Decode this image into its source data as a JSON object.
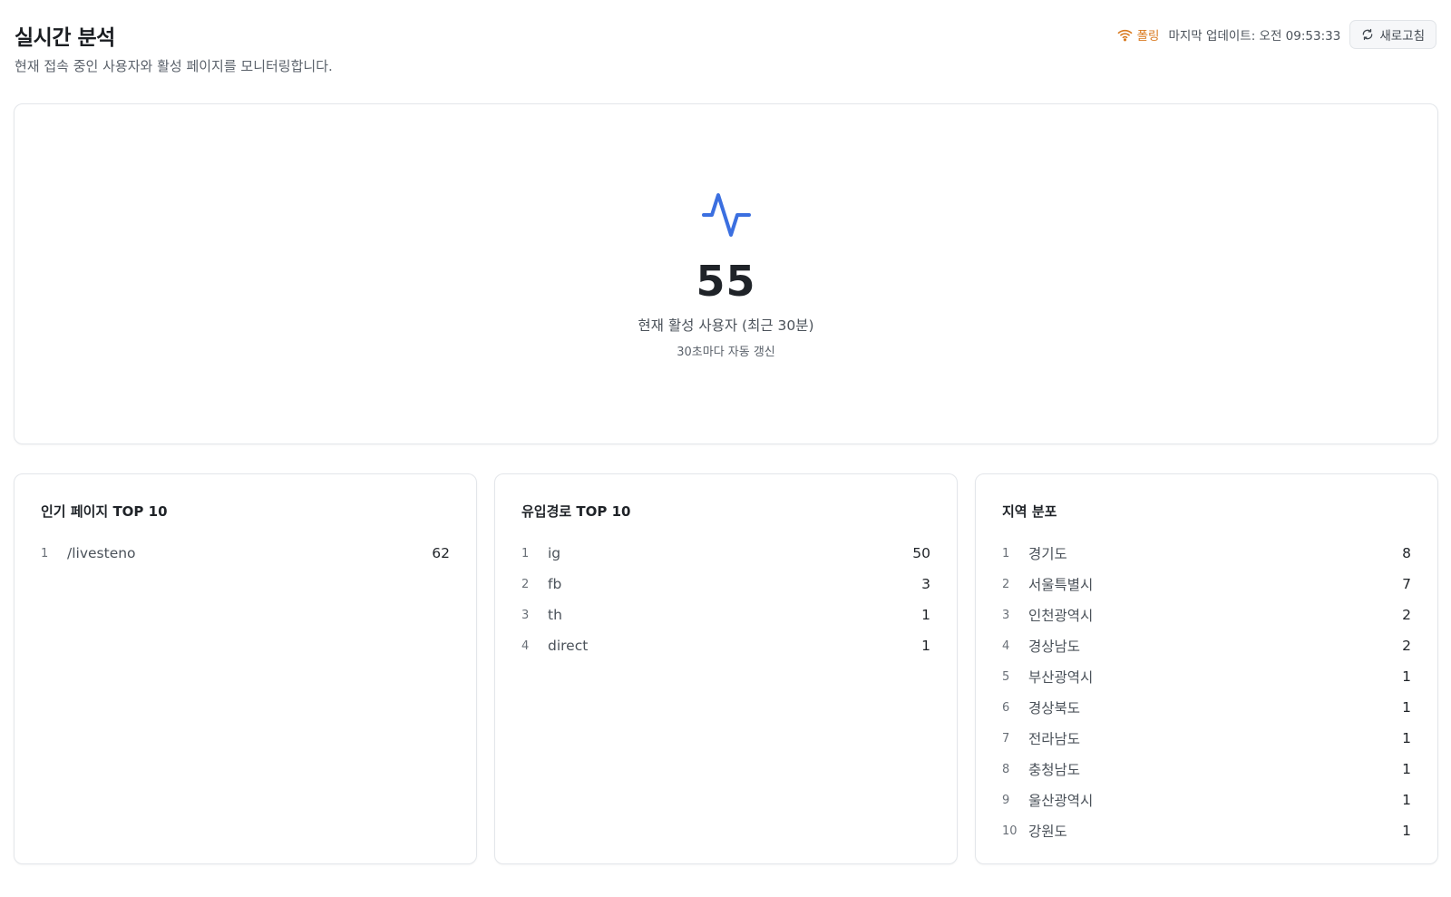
{
  "header": {
    "title": "실시간 분석",
    "subtitle": "현재 접속 중인 사용자와 활성 페이지를 모니터링합니다.",
    "polling_label": "폴링",
    "last_update": "마지막 업데이트: 오전 09:53:33",
    "refresh_label": "새로고침"
  },
  "hero": {
    "value": "55",
    "label": "현재 활성 사용자 (최근 30분)",
    "sub": "30초마다 자동 갱신"
  },
  "popular_pages": {
    "title": "인기 페이지 TOP 10",
    "items": [
      {
        "rank": "1",
        "name": "/livesteno",
        "count": "62"
      }
    ]
  },
  "referrers": {
    "title": "유입경로 TOP 10",
    "items": [
      {
        "rank": "1",
        "name": "ig",
        "count": "50"
      },
      {
        "rank": "2",
        "name": "fb",
        "count": "3"
      },
      {
        "rank": "3",
        "name": "th",
        "count": "1"
      },
      {
        "rank": "4",
        "name": "direct",
        "count": "1"
      }
    ]
  },
  "regions": {
    "title": "지역 분포",
    "items": [
      {
        "rank": "1",
        "name": "경기도",
        "count": "8"
      },
      {
        "rank": "2",
        "name": "서울특별시",
        "count": "7"
      },
      {
        "rank": "3",
        "name": "인천광역시",
        "count": "2"
      },
      {
        "rank": "4",
        "name": "경상남도",
        "count": "2"
      },
      {
        "rank": "5",
        "name": "부산광역시",
        "count": "1"
      },
      {
        "rank": "6",
        "name": "경상북도",
        "count": "1"
      },
      {
        "rank": "7",
        "name": "전라남도",
        "count": "1"
      },
      {
        "rank": "8",
        "name": "충청남도",
        "count": "1"
      },
      {
        "rank": "9",
        "name": "울산광역시",
        "count": "1"
      },
      {
        "rank": "10",
        "name": "강원도",
        "count": "1"
      }
    ]
  },
  "icons": {
    "polling": "wifi-icon",
    "refresh": "refresh-icon",
    "hero": "activity-icon"
  },
  "colors": {
    "accent": "#3b6fe0",
    "polling": "#d97a20"
  }
}
